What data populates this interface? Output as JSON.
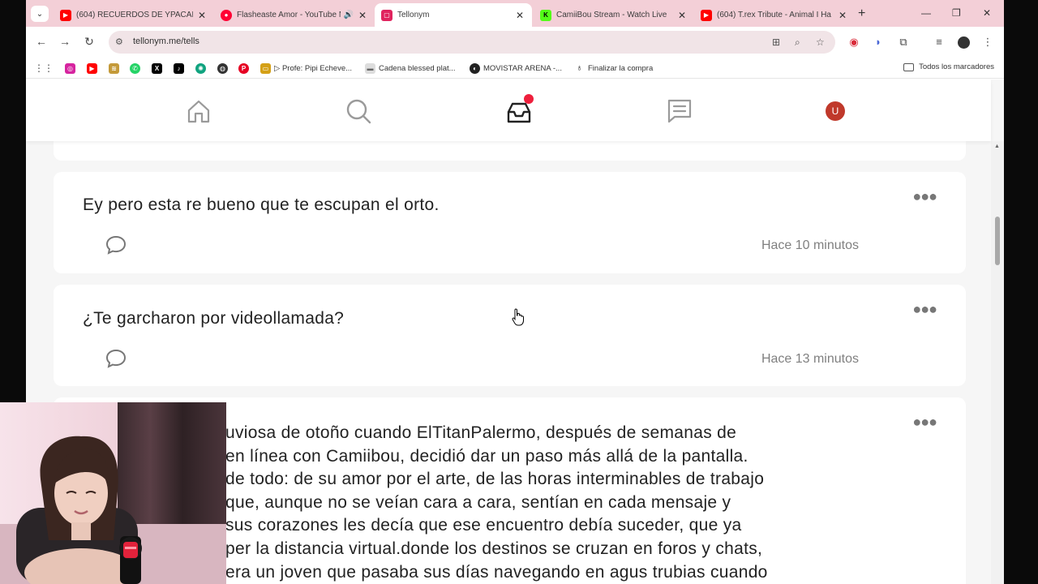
{
  "tabs": [
    {
      "title": "(604) RECUERDOS DE YPACARAI",
      "icon": "youtube-icon",
      "color": "#ff0000"
    },
    {
      "title": "Flasheaste Amor - YouTube M",
      "icon": "youtube-music-icon",
      "color": "#ff0033"
    },
    {
      "title": "Tellonym",
      "icon": "tellonym-icon",
      "color": "#e0245e"
    },
    {
      "title": "CamiiBou Stream - Watch Live",
      "icon": "kick-icon",
      "color": "#53fc18"
    },
    {
      "title": "(604) T.rex Tribute - Animal I Ha",
      "icon": "youtube-icon",
      "color": "#ff0000"
    }
  ],
  "toolbar": {
    "url": "tellonym.me/tells"
  },
  "bookmarks": [
    {
      "label": "",
      "icon": "instagram-icon",
      "color": "#d6249f"
    },
    {
      "label": "",
      "icon": "youtube-icon",
      "color": "#ff0000"
    },
    {
      "label": "",
      "icon": "wallet-icon",
      "color": "#c49a3a"
    },
    {
      "label": "",
      "icon": "whatsapp-icon",
      "color": "#25d366"
    },
    {
      "label": "",
      "icon": "x-icon",
      "color": "#000000"
    },
    {
      "label": "",
      "icon": "tiktok-icon",
      "color": "#000000"
    },
    {
      "label": "",
      "icon": "chatgpt-icon",
      "color": "#10a37f"
    },
    {
      "label": "",
      "icon": "bookmark-icon",
      "color": "#333333"
    },
    {
      "label": "",
      "icon": "pinterest-icon",
      "color": "#e60023"
    },
    {
      "label": "▷ Profe: Pipi Echeve...",
      "icon": "folder-icon",
      "color": "#d4a017"
    },
    {
      "label": "Cadena blessed plat...",
      "icon": "page-icon",
      "color": "#bbbbbb"
    },
    {
      "label": "MOVISTAR ARENA -...",
      "icon": "movistar-icon",
      "color": "#222222"
    },
    {
      "label": "Finalizar la compra",
      "icon": "checkout-icon",
      "color": "#222222"
    }
  ],
  "bookmarks_all": "Todos los marcadores",
  "tells": [
    {
      "text": "Ey pero esta re bueno que te escupan el orto.",
      "time": "Hace 10 minutos"
    },
    {
      "text": "¿Te garcharon por videollamada?",
      "time": "Hace 13 minutos"
    }
  ],
  "story_lines": [
    "uviosa de otoño cuando ElTitanPalermo, después de semanas de",
    " en línea con Camiibou, decidió dar un paso más allá de la pantalla.",
    " de todo: de su amor por el arte, de las horas interminables de trabajo",
    "que, aunque no se veían cara a cara, sentían en cada mensaje y",
    " sus corazones les decía que ese encuentro debía suceder, que ya",
    "per la distancia virtual.donde los destinos se cruzan en foros y chats,",
    "era un joven que pasaba sus días navegando en agus trubias cuando"
  ],
  "avatar_letter": "U"
}
